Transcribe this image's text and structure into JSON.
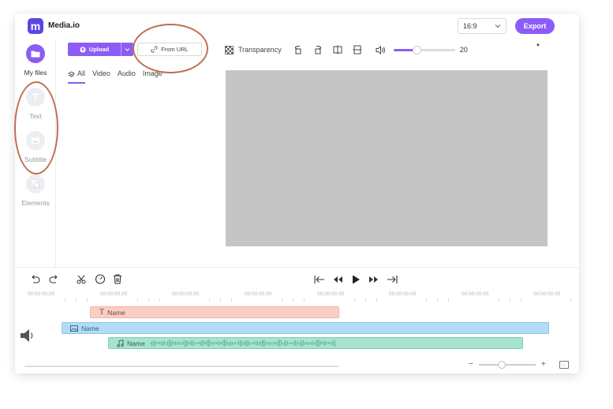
{
  "header": {
    "logo_letter": "m",
    "app_title": "Media.io",
    "aspect_ratio": "16:9",
    "export_label": "Export",
    "brand_color": "#8b5cf6"
  },
  "sidebar": {
    "items": [
      {
        "label": "My files",
        "icon": "folder-icon",
        "active": true
      },
      {
        "label": "Text",
        "icon": "text-icon",
        "active": false
      },
      {
        "label": "Subtitle",
        "icon": "subtitle-icon",
        "active": false
      },
      {
        "label": "Elements",
        "icon": "elements-icon",
        "active": false
      }
    ]
  },
  "media": {
    "upload_label": "Upload",
    "from_url_label": "From URL",
    "tabs": [
      {
        "label": "All",
        "active": true
      },
      {
        "label": "Video"
      },
      {
        "label": "Audio"
      },
      {
        "label": "Image"
      }
    ]
  },
  "toolbar": {
    "transparency_label": "Transparency",
    "volume_value": "20",
    "volume_fraction": 0.38
  },
  "timeline": {
    "timestamps": [
      "00:00:00.00",
      "00:00:00.00",
      "00:00:00.00",
      "00:00:00.00",
      "00:00:00.00",
      "00:00:00.00",
      "00:00:00.00",
      "00:00:00.00"
    ],
    "tracks": [
      {
        "type": "text",
        "label": "Name",
        "color": "#f9cfc2"
      },
      {
        "type": "video",
        "label": "Name",
        "color": "#b3dcf4"
      },
      {
        "type": "audio",
        "label": "Name",
        "color": "#a8e3cf"
      }
    ],
    "zoom_minus": "−",
    "zoom_plus": "+"
  }
}
